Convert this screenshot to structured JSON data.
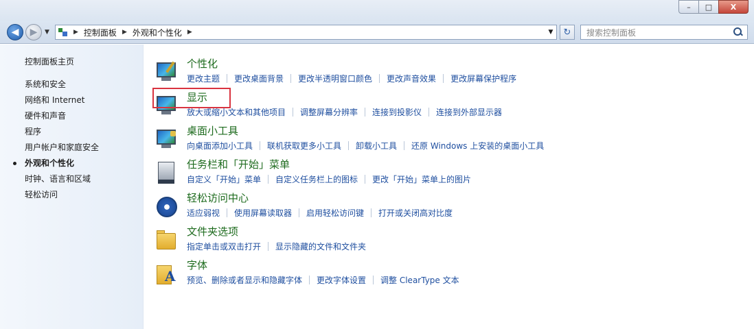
{
  "window": {
    "controls": {
      "minimize": "–",
      "maximize": "□",
      "close": "X"
    }
  },
  "address": {
    "crumbs": [
      "控制面板",
      "外观和个性化"
    ],
    "search_placeholder": "搜索控制面板"
  },
  "sidebar": {
    "home": "控制面板主页",
    "items": [
      {
        "label": "系统和安全",
        "active": false
      },
      {
        "label": "网络和 Internet",
        "active": false
      },
      {
        "label": "硬件和声音",
        "active": false
      },
      {
        "label": "程序",
        "active": false
      },
      {
        "label": "用户帐户和家庭安全",
        "active": false
      },
      {
        "label": "外观和个性化",
        "active": true
      },
      {
        "label": "时钟、语言和区域",
        "active": false
      },
      {
        "label": "轻松访问",
        "active": false
      }
    ]
  },
  "categories": [
    {
      "title": "个性化",
      "icon": "personalization-icon",
      "links": [
        "更改主题",
        "更改桌面背景",
        "更改半透明窗口颜色",
        "更改声音效果",
        "更改屏幕保护程序"
      ]
    },
    {
      "title": "显示",
      "icon": "display-icon",
      "links": [
        "放大或缩小文本和其他项目",
        "调整屏幕分辨率",
        "连接到投影仪",
        "连接到外部显示器"
      ]
    },
    {
      "title": "桌面小工具",
      "icon": "desktop-gadgets-icon",
      "links": [
        "向桌面添加小工具",
        "联机获取更多小工具",
        "卸载小工具",
        "还原 Windows 上安装的桌面小工具"
      ]
    },
    {
      "title": "任务栏和「开始」菜单",
      "icon": "taskbar-icon",
      "links": [
        "自定义「开始」菜单",
        "自定义任务栏上的图标",
        "更改「开始」菜单上的图片"
      ]
    },
    {
      "title": "轻松访问中心",
      "icon": "ease-of-access-icon",
      "links": [
        "适应弱视",
        "使用屏幕读取器",
        "启用轻松访问键",
        "打开或关闭高对比度"
      ]
    },
    {
      "title": "文件夹选项",
      "icon": "folder-options-icon",
      "links": [
        "指定单击或双击打开",
        "显示隐藏的文件和文件夹"
      ]
    },
    {
      "title": "字体",
      "icon": "fonts-icon",
      "links": [
        "预览、删除或者显示和隐藏字体",
        "更改字体设置",
        "调整 ClearType 文本"
      ]
    }
  ],
  "colors": {
    "category_title": "#1e6b1e",
    "link": "#1e4e9f",
    "highlight": "#d9333f"
  }
}
